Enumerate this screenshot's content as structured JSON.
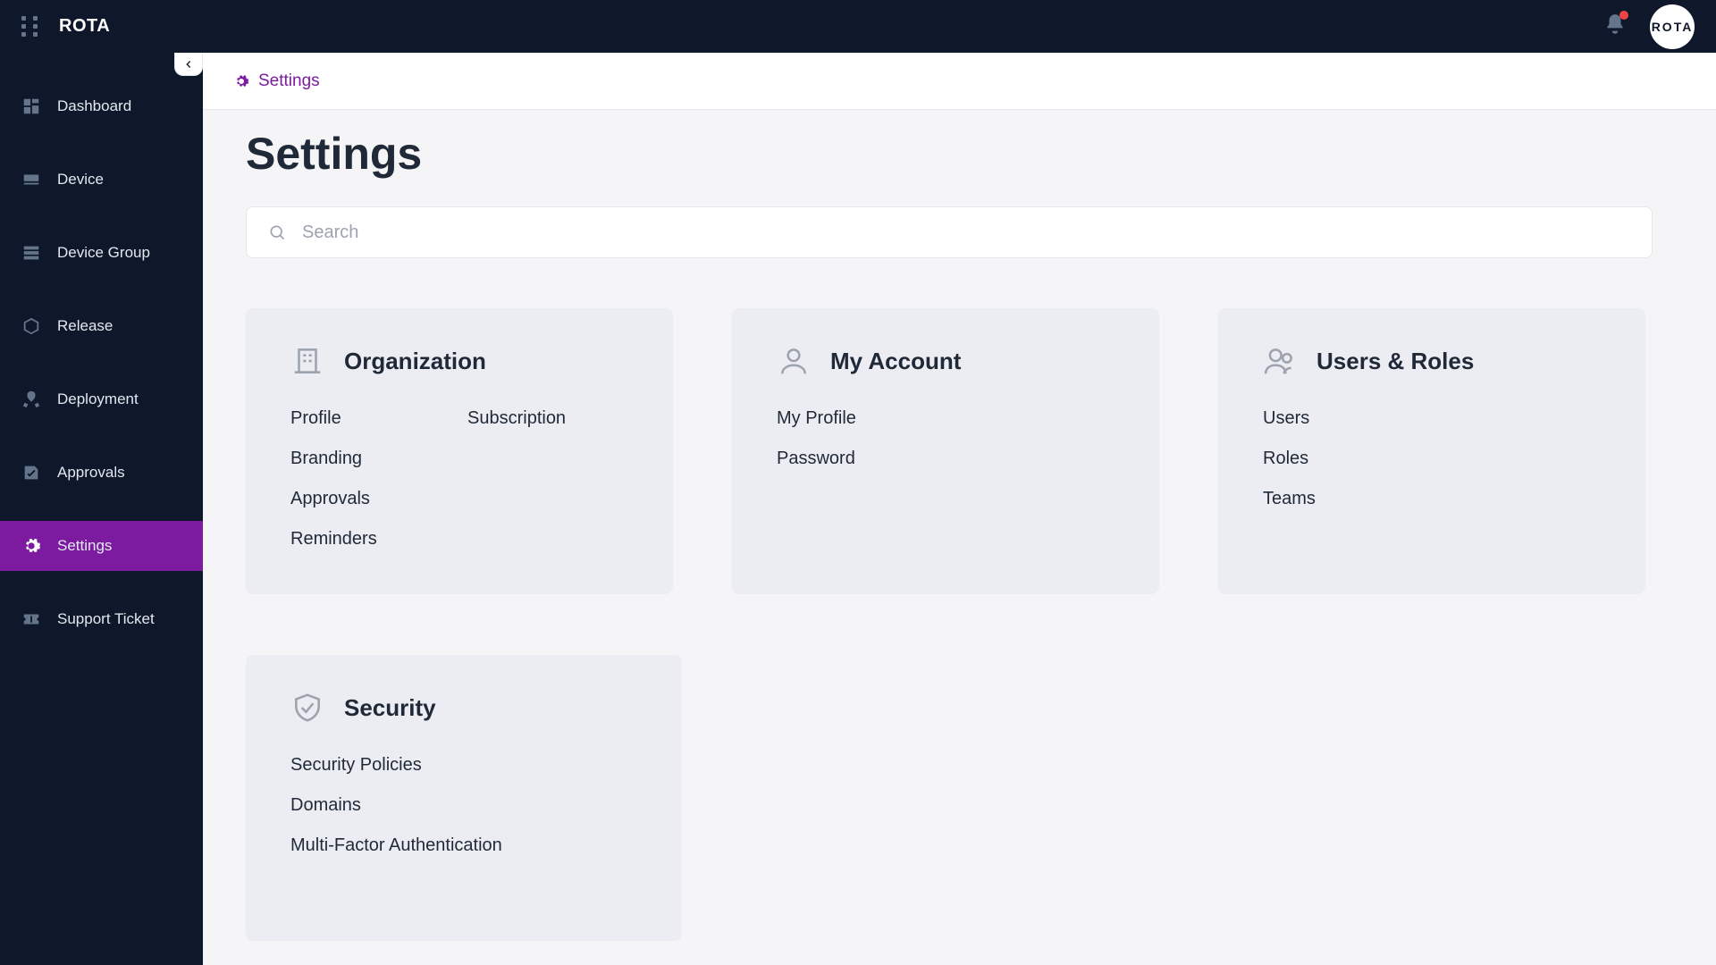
{
  "brand": "ROTA",
  "avatar_text": "ROTA",
  "sidebar": {
    "items": [
      {
        "label": "Dashboard"
      },
      {
        "label": "Device"
      },
      {
        "label": "Device Group"
      },
      {
        "label": "Release"
      },
      {
        "label": "Deployment"
      },
      {
        "label": "Approvals"
      },
      {
        "label": "Settings"
      },
      {
        "label": "Support Ticket"
      }
    ]
  },
  "breadcrumb": {
    "current": "Settings"
  },
  "page": {
    "title": "Settings"
  },
  "search": {
    "placeholder": "Search"
  },
  "cards": {
    "org": {
      "title": "Organization",
      "links": [
        "Profile",
        "Subscription",
        "Branding",
        "Approvals",
        "Reminders"
      ]
    },
    "account": {
      "title": "My Account",
      "links": [
        "My Profile",
        "Password"
      ]
    },
    "users": {
      "title": "Users & Roles",
      "links": [
        "Users",
        "Roles",
        "Teams"
      ]
    },
    "security": {
      "title": "Security",
      "links": [
        "Security Policies",
        "Domains",
        "Multi-Factor Authentication"
      ]
    }
  }
}
